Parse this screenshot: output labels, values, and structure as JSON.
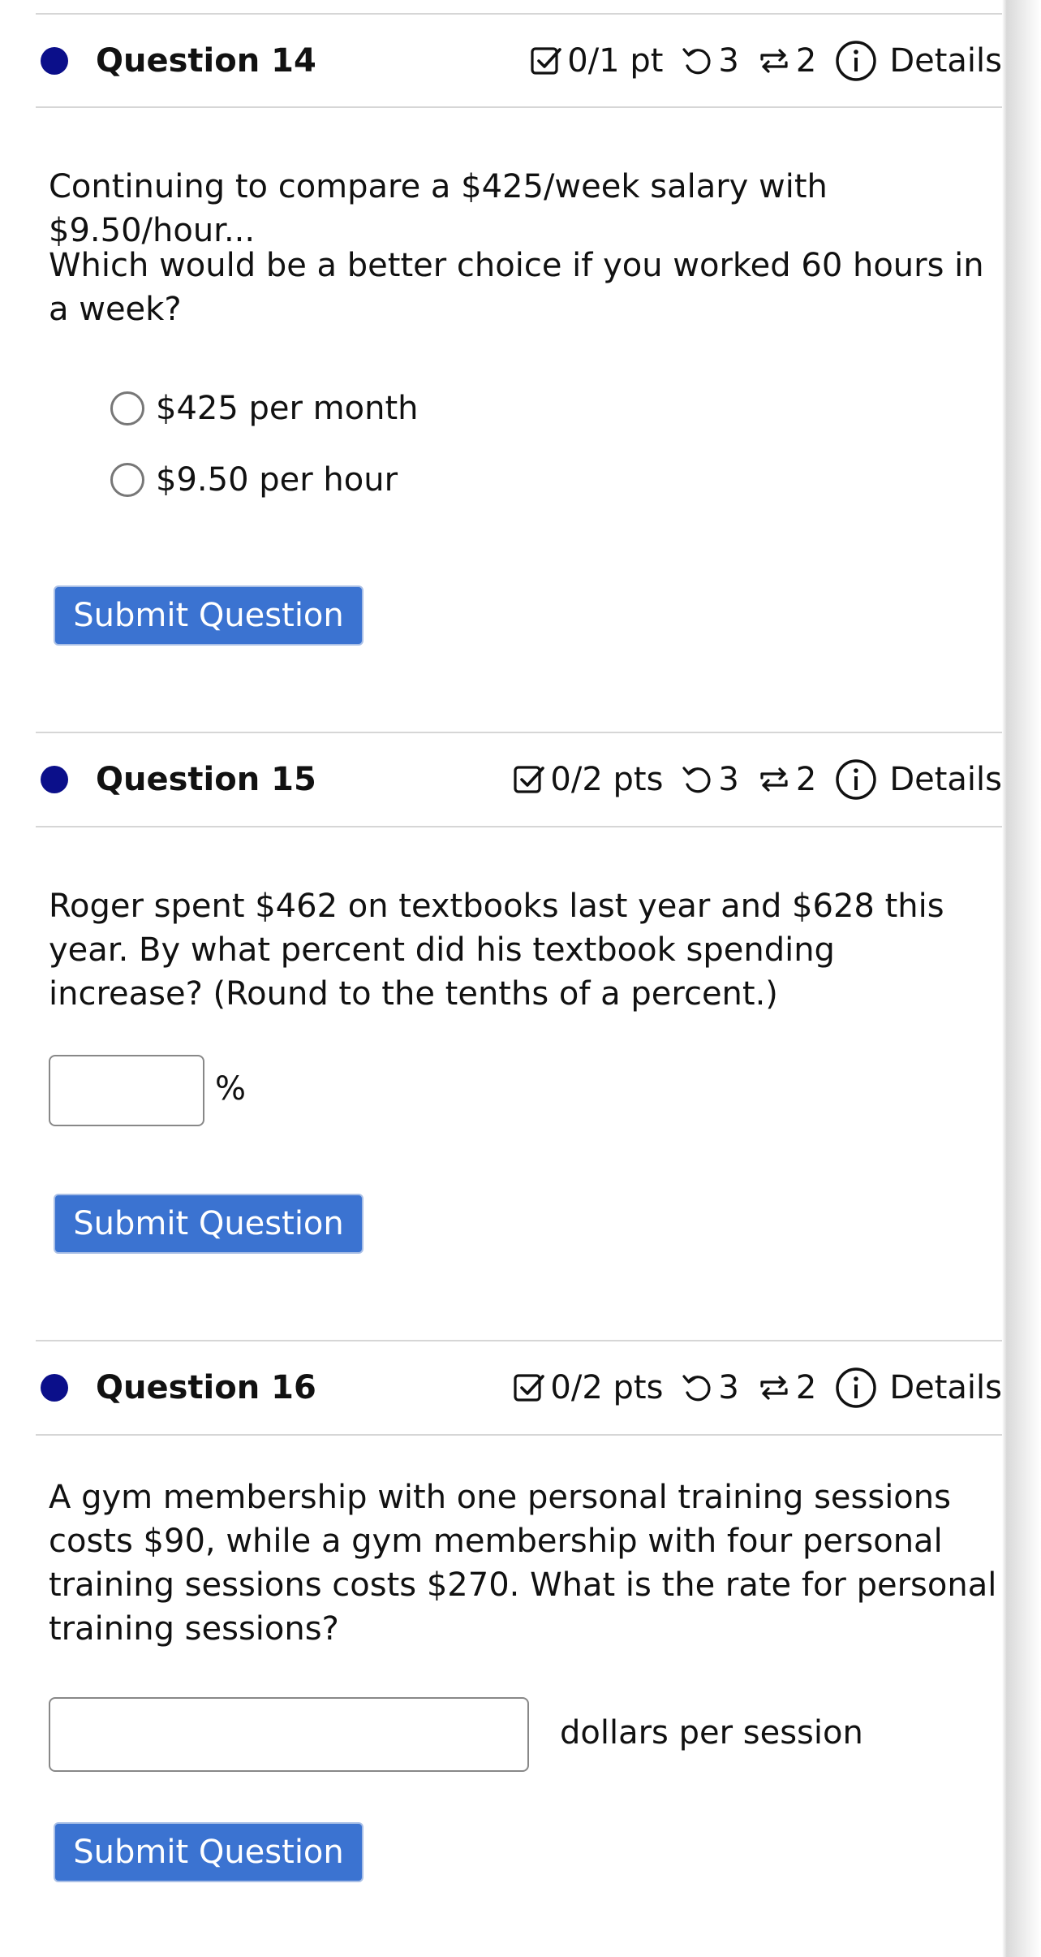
{
  "questions": [
    {
      "title": "Question 14",
      "score": "0/1 pt",
      "retries": "3",
      "versions": "2",
      "details": "Details",
      "text": "Continuing to compare a $425/week salary with $9.50/hour...",
      "prompt": "Which would be a better choice if you worked 60 hours in a week?",
      "options": [
        "$425 per month",
        "$9.50 per hour"
      ],
      "submit": "Submit Question"
    },
    {
      "title": "Question 15",
      "score": "0/2 pts",
      "retries": "3",
      "versions": "2",
      "details": "Details",
      "text": "Roger spent $462 on textbooks last year and $628 this year. By what percent did his textbook spending increase? (Round to the tenths of a percent.)",
      "answer_value": "",
      "answer_suffix": "%",
      "submit": "Submit Question"
    },
    {
      "title": "Question 16",
      "score": "0/2 pts",
      "retries": "3",
      "versions": "2",
      "details": "Details",
      "text": "A gym membership with one personal training sessions costs $90, while a gym membership with four personal training sessions costs $270. What is the rate for personal training sessions?",
      "answer_value": "",
      "answer_suffix": "dollars per session",
      "submit": "Submit Question"
    }
  ],
  "colors": {
    "dot": "#0b0f8a",
    "button": "#3b73d1"
  },
  "icons": [
    "checkbox-icon",
    "retry-icon",
    "versions-icon",
    "info-icon"
  ]
}
